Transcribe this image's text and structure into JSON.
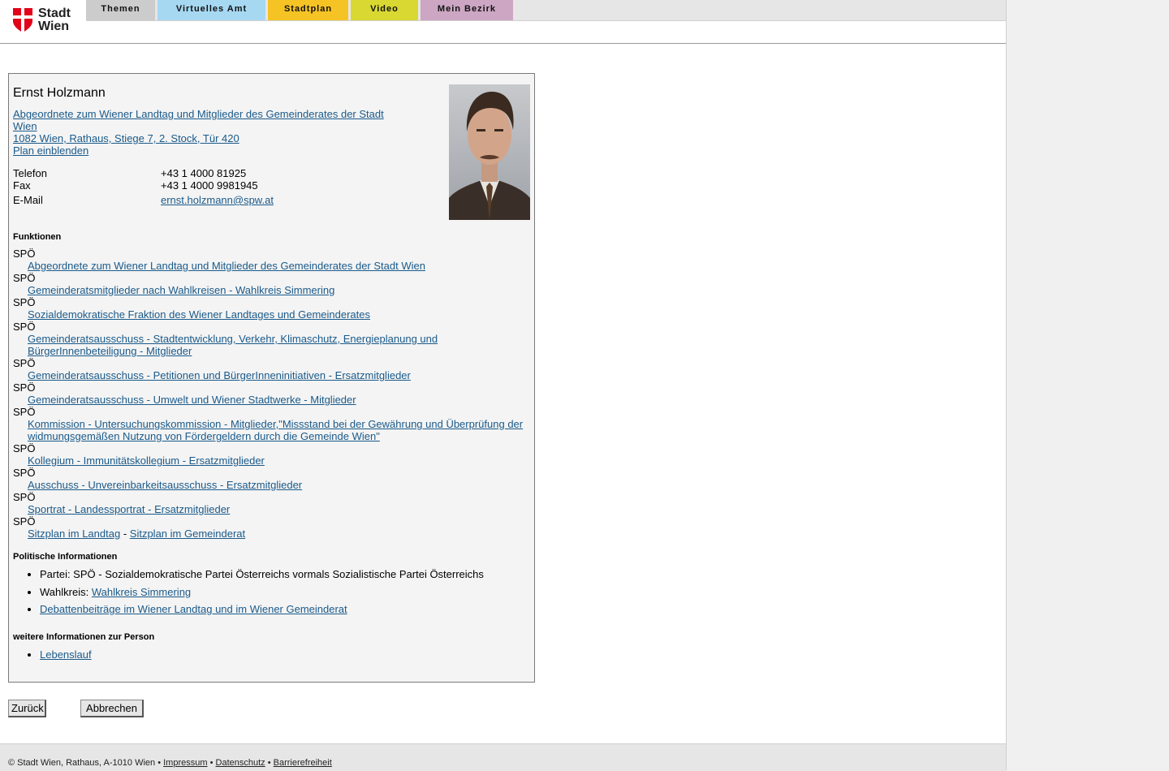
{
  "logo": {
    "line1": "Stadt",
    "line2": "Wien"
  },
  "nav": {
    "tabs": [
      "Themen",
      "Virtuelles Amt",
      "Stadtplan",
      "Video",
      "Mein Bezirk"
    ]
  },
  "person": {
    "name": "Ernst Holzmann",
    "role_link": "Abgeordnete zum Wiener Landtag und Mitglieder des Gemeinderates der Stadt Wien",
    "address_link": "1082 Wien, Rathaus, Stiege 7, 2. Stock, Tür 420",
    "plan_link": "Plan einblenden"
  },
  "contact": {
    "phone_label": "Telefon",
    "phone": "+43 1 4000 81925",
    "fax_label": "Fax",
    "fax": "+43 1 4000 9981945",
    "email_label": "E-Mail",
    "email": "ernst.holzmann@spw.at"
  },
  "functions": {
    "heading": "Funktionen",
    "items": [
      {
        "party": "SPÖ",
        "label": "Abgeordnete zum Wiener Landtag und Mitglieder des Gemeinderates der Stadt Wien"
      },
      {
        "party": "SPÖ",
        "label": "Gemeinderatsmitglieder nach Wahlkreisen - Wahlkreis Simmering"
      },
      {
        "party": "SPÖ",
        "label": "Sozialdemokratische Fraktion des Wiener Landtages und Gemeinderates"
      },
      {
        "party": "SPÖ",
        "label": "Gemeinderatsausschuss - Stadtentwicklung, Verkehr, Klimaschutz, Energieplanung und BürgerInnenbeteiligung - Mitglieder"
      },
      {
        "party": "SPÖ",
        "label": "Gemeinderatsausschuss - Petitionen und BürgerInneninitiativen - Ersatzmitglieder"
      },
      {
        "party": "SPÖ",
        "label": "Gemeinderatsausschuss - Umwelt und Wiener Stadtwerke - Mitglieder"
      },
      {
        "party": "SPÖ",
        "label": "Kommission - Untersuchungskommission - Mitglieder,\"Missstand bei der Gewährung und Überprüfung der widmungsgemäßen Nutzung von Fördergeldern durch die Gemeinde Wien\""
      },
      {
        "party": "SPÖ",
        "label": "Kollegium - Immunitätskollegium - Ersatzmitglieder"
      },
      {
        "party": "SPÖ",
        "label": "Ausschuss - Unvereinbarkeitsausschuss - Ersatzmitglieder"
      },
      {
        "party": "SPÖ",
        "label": "Sportrat - Landessportrat - Ersatzmitglieder"
      }
    ],
    "seating": {
      "party": "SPÖ",
      "landtag": "Sitzplan im Landtag",
      "separator": "-",
      "gemeinderat": "Sitzplan im Gemeinderat"
    }
  },
  "political": {
    "heading": "Politische Informationen",
    "party_text": "Partei: SPÖ - Sozialdemokratische Partei Österreichs vormals Sozialistische Partei Österreichs",
    "district_label": "Wahlkreis:",
    "district_link": "Wahlkreis Simmering",
    "debates_link": "Debattenbeiträge im Wiener Landtag und im Wiener Gemeinderat"
  },
  "more": {
    "heading": "weitere Informationen zur Person",
    "cv_link": "Lebenslauf"
  },
  "buttons": {
    "back": "Zurück",
    "cancel": "Abbrechen"
  },
  "footer": {
    "copyright": "© Stadt Wien, Rathaus, A-1010 Wien",
    "bullet": "•",
    "impressum": "Impressum",
    "datenschutz": "Datenschutz",
    "barrierefreiheit": "Barrierefreiheit"
  },
  "colors": {
    "link": "#1a5a8a",
    "tab_themen": "#cccccc",
    "tab_amt": "#a6d8f2",
    "tab_stadtplan": "#f6c324",
    "tab_video": "#d9d832",
    "tab_bezirk": "#cca6c3",
    "logo_red": "#e2001a"
  }
}
